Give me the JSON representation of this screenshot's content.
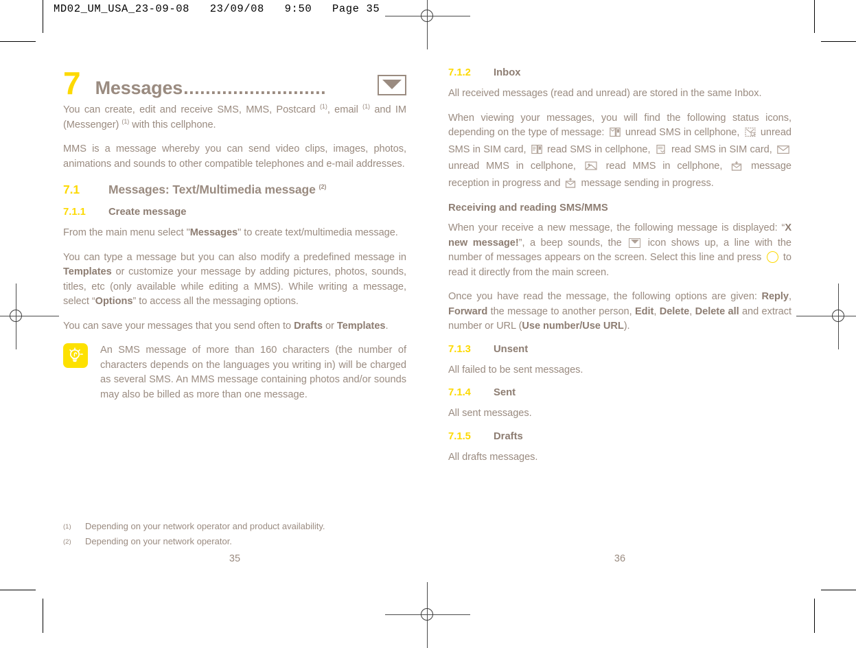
{
  "print_slug": "MD02_UM_USA_23-09-08   23/09/08   9:50   Page 35",
  "chapter": {
    "number": "7",
    "title": "Messages",
    "dots": "..........................",
    "icon": "envelope-icon"
  },
  "left_page": {
    "intro_1_a": "You can create, edit and receive SMS, MMS, Postcard ",
    "intro_1_fn1": "(1)",
    "intro_1_b": ", email ",
    "intro_1_fn2": "(1)",
    "intro_1_c": " and IM (Messenger) ",
    "intro_1_fn3": "(1)",
    "intro_1_d": " with this cellphone.",
    "intro_2": "MMS is a message whereby you can send video clips, images, photos, animations and sounds to other compatible telephones and e-mail addresses.",
    "section_7_1": {
      "number": "7.1",
      "label": "Messages: Text/Multimedia message ",
      "footnote": "(2)"
    },
    "section_7_1_1": {
      "number": "7.1.1",
      "label": "Create message"
    },
    "para_from_a": "From the main menu select \"",
    "para_from_b": "Messages",
    "para_from_c": "\" to create text/multimedia message.",
    "para_type_a": "You can type a message but you can also modify a predefined message in ",
    "para_type_b": "Templates",
    "para_type_c": " or customize your message by adding pictures, photos, sounds, titles, etc (only available while editing a MMS). While writing a message, select “",
    "para_type_d": "Options",
    "para_type_e": "” to access all the messaging options.",
    "para_save_a": "You can save your messages that you send often to ",
    "para_save_b": "Drafts",
    "para_save_c": " or ",
    "para_save_d": "Templates",
    "para_save_e": ".",
    "note": {
      "icon": "lightbulb-icon",
      "text": "An SMS message of more than 160 characters (the number of characters depends on the languages you writing in) will be charged as several SMS. An MMS message containing photos and/or sounds may also be billed as more than one message."
    }
  },
  "right_page": {
    "section_7_1_2": {
      "number": "7.1.2",
      "label": "Inbox"
    },
    "para_inbox": "All received messages (read and unread) are stored in the same Inbox.",
    "para_status_intro": "When viewing your messages, you will find the following status icons, depending on the type of message:",
    "status_icons": [
      {
        "icon": "unread-sms-cellphone-icon",
        "label": "unread SMS in cellphone,"
      },
      {
        "icon": "unread-sms-sim-icon",
        "label": "unread SMS in SIM card,"
      },
      {
        "icon": "read-sms-cellphone-icon",
        "label": "read SMS in cellphone,"
      },
      {
        "icon": "read-sms-sim-icon",
        "label": "read SMS in SIM card,"
      },
      {
        "icon": "unread-mms-cellphone-icon",
        "label": "unread MMS in cellphone,"
      },
      {
        "icon": "read-mms-cellphone-icon",
        "label": "read MMS in cellphone,"
      },
      {
        "icon": "message-reception-icon",
        "label": "message reception in progress and"
      },
      {
        "icon": "message-sending-icon",
        "label": "message sending in progress."
      }
    ],
    "heading_receiving": "Receiving and reading SMS/MMS",
    "para_receive_a": "When your receive a new message, the following message is displayed: “",
    "para_receive_b": "X new message!",
    "para_receive_c": "”, a beep sounds, the ",
    "para_receive_icon": "envelope-closed-icon",
    "para_receive_d": " icon shows up, a line with the number of messages appears on the screen. Select this line and press ",
    "para_receive_key_icon": "ok-key-circle-icon",
    "para_receive_e": " to read it directly from the main screen.",
    "para_options_a": "Once you have read the message, the following options are given: ",
    "para_options_reply": "Reply",
    "para_options_b": ", ",
    "para_options_forward": "Forward",
    "para_options_c": " the message to another person, ",
    "para_options_edit": "Edit",
    "para_options_d": ", ",
    "para_options_delete": "Delete",
    "para_options_e": ", ",
    "para_options_delete_all": "Delete all",
    "para_options_f": " and extract number or URL (",
    "para_options_use": "Use number/Use URL",
    "para_options_g": ").",
    "section_7_1_3": {
      "number": "7.1.3",
      "label": "Unsent"
    },
    "para_unsent": "All failed to be sent messages.",
    "section_7_1_4": {
      "number": "7.1.4",
      "label": "Sent"
    },
    "para_sent": "All sent messages.",
    "section_7_1_5": {
      "number": "7.1.5",
      "label": "Drafts"
    },
    "para_drafts": "All drafts messages."
  },
  "footnotes": [
    {
      "mark": "(1)",
      "text": "Depending on your network operator and product availability."
    },
    {
      "mark": "(2)",
      "text": "Depending on your network operator."
    }
  ],
  "page_numbers": {
    "left": "35",
    "right": "36"
  },
  "colors": {
    "accent_yellow": "#fdd900",
    "body_taupe": "#9a8b80",
    "heading_taupe": "#8d7d72"
  }
}
